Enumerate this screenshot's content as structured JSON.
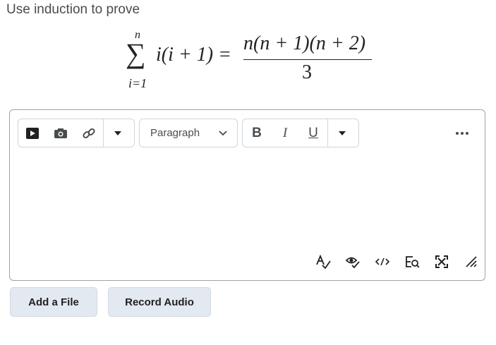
{
  "question": {
    "prompt": "Use induction to prove",
    "formula": {
      "sigma": "∑",
      "upper": "n",
      "lower": "i=1",
      "lhs": "i(i + 1) =",
      "numerator": "n(n + 1)(n + 2)",
      "denominator": "3"
    }
  },
  "toolbar": {
    "block_format": "Paragraph",
    "bold_label": "B",
    "italic_label": "I",
    "underline_label": "U"
  },
  "actions": {
    "add_file": "Add a File",
    "record_audio": "Record Audio"
  }
}
